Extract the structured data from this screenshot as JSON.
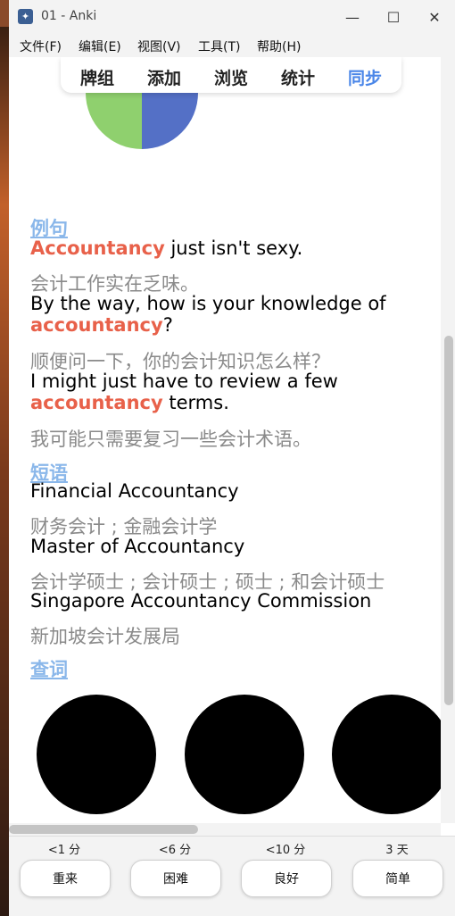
{
  "window": {
    "title": "01 - Anki",
    "app_icon_glyph": "✦"
  },
  "window_controls": {
    "minimize_glyph": "—",
    "maximize_glyph": "☐",
    "close_glyph": "✕"
  },
  "menubar": [
    "文件(F)",
    "编辑(E)",
    "视图(V)",
    "工具(T)",
    "帮助(H)"
  ],
  "topnav": [
    {
      "label": "牌组",
      "color": "#222222"
    },
    {
      "label": "添加",
      "color": "#222222"
    },
    {
      "label": "浏览",
      "color": "#222222"
    },
    {
      "label": "统计",
      "color": "#222222"
    },
    {
      "label": "同步",
      "color": "#4a86e8"
    }
  ],
  "pie_colors": {
    "green": "#8fd06e",
    "blue": "#5470c6"
  },
  "sections": {
    "examples_label": "例句",
    "phrases_label": "短语",
    "lookup_label": "查词"
  },
  "examples": [
    {
      "hl": "Accountancy",
      "after": " just isn't sexy.",
      "zh": "会计工作实在乏味。"
    },
    {
      "before": "By the way, how is your knowledge of",
      "hl": "accountancy",
      "after": "?",
      "zh": "顺便问一下，你的会计知识怎么样？"
    },
    {
      "before": "I might just have to review a few",
      "hl": "accountancy",
      "after": " terms.",
      "zh": "我可能只需要复习一些会计术语。"
    }
  ],
  "phrases": [
    {
      "en": "Financial Accountancy",
      "zh": "财务会计 ; 金融会计学"
    },
    {
      "en": "Master of Accountancy",
      "zh": "会计学硕士 ; 会计硕士 ; 硕士 ; 和会计硕士"
    },
    {
      "en": "Singapore Accountancy Commission",
      "zh": "新加坡会计发展局"
    }
  ],
  "answers": [
    {
      "interval": "<1 分",
      "label": "重来"
    },
    {
      "interval": "<6 分",
      "label": "困难"
    },
    {
      "interval": "<10 分",
      "label": "良好"
    },
    {
      "interval": "3 天",
      "label": "简单"
    }
  ]
}
